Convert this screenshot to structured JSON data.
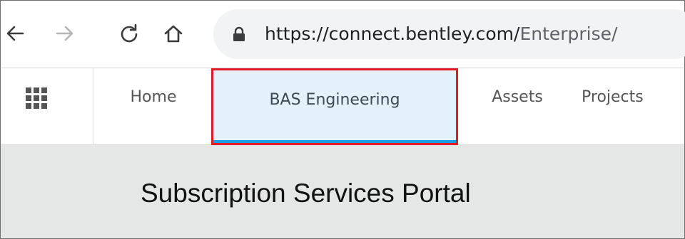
{
  "browser": {
    "back_icon": "arrow-left-icon",
    "forward_icon": "arrow-right-icon",
    "reload_icon": "reload-icon",
    "home_icon": "home-icon",
    "lock_icon": "lock-icon",
    "url_host": "https://connect.bentley.com/",
    "url_path": "Enterprise/"
  },
  "nav": {
    "apps_icon": "apps-grid-icon",
    "items": [
      {
        "label": "Home"
      },
      {
        "label": "BAS Engineering",
        "active": true,
        "highlighted": true
      },
      {
        "label": "Assets"
      },
      {
        "label": "Projects"
      }
    ]
  },
  "main": {
    "title": "Subscription Services Portal"
  },
  "colors": {
    "active_tab_bg": "#e4f1fb",
    "active_underline": "#1a9ee0",
    "highlight_box": "#e21b2b",
    "content_bg": "#e5e6e6"
  }
}
